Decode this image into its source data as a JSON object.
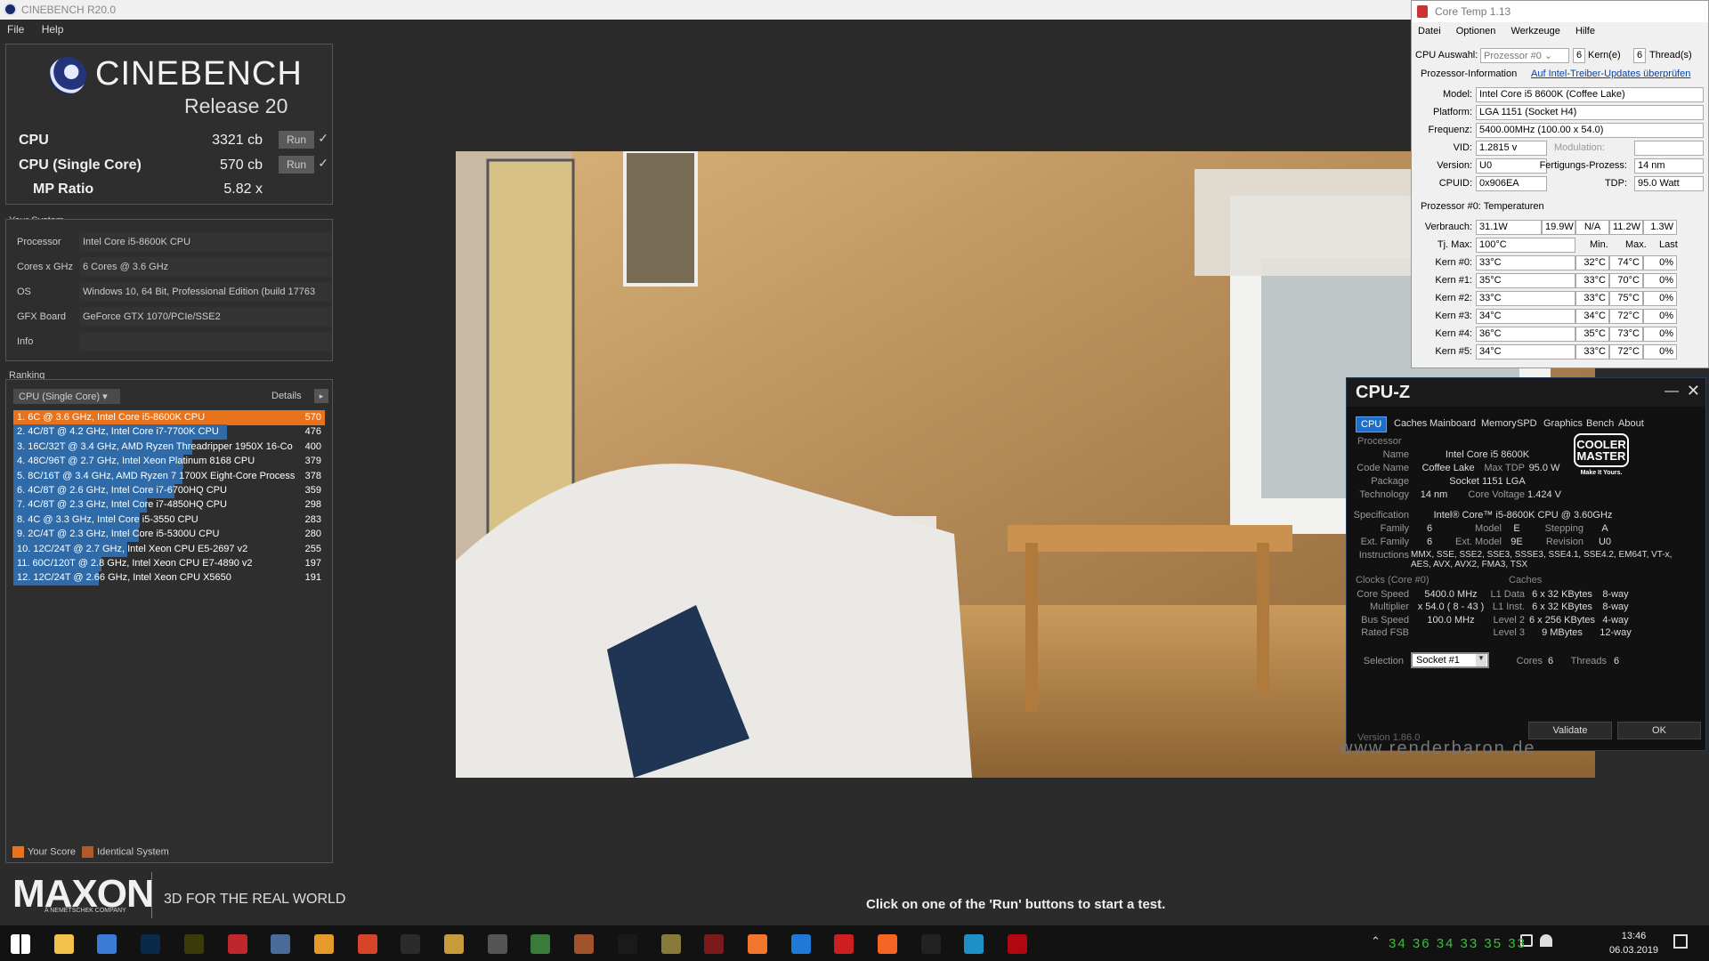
{
  "cinebench": {
    "window_title": "CINEBENCH R20.0",
    "menu": [
      "File",
      "Help"
    ],
    "logo_title": "CINEBENCH",
    "logo_release": "Release 20",
    "scores": [
      {
        "label": "CPU",
        "value": "3321 cb",
        "run": "Run",
        "check": "✓"
      },
      {
        "label": "CPU (Single Core)",
        "value": "570 cb",
        "run": "Run",
        "check": "✓"
      }
    ],
    "mp_ratio": {
      "label": "MP Ratio",
      "value": "5.82 x"
    },
    "your_system": {
      "title": "Your System",
      "rows": [
        {
          "key": "Processor",
          "value": "Intel Core i5-8600K CPU"
        },
        {
          "key": "Cores x GHz",
          "value": "6 Cores @ 3.6 GHz"
        },
        {
          "key": "OS",
          "value": "Windows 10, 64 Bit, Professional Edition (build 17763"
        },
        {
          "key": "GFX Board",
          "value": "GeForce GTX 1070/PCIe/SSE2"
        },
        {
          "key": "Info",
          "value": ""
        }
      ]
    },
    "ranking": {
      "title": "Ranking",
      "dropdown": "CPU (Single Core)",
      "details": "Details",
      "rows": [
        {
          "text": "1. 6C @ 3.6 GHz, Intel Core i5-8600K CPU",
          "score": 570,
          "mine": true
        },
        {
          "text": "2. 4C/8T @ 4.2 GHz, Intel Core i7-7700K CPU",
          "score": 476
        },
        {
          "text": "3. 16C/32T @ 3.4 GHz, AMD Ryzen Threadripper 1950X 16-Co",
          "score": 400
        },
        {
          "text": "4. 48C/96T @ 2.7 GHz, Intel Xeon Platinum 8168 CPU",
          "score": 379
        },
        {
          "text": "5. 8C/16T @ 3.4 GHz, AMD Ryzen 7 1700X Eight-Core Process",
          "score": 378
        },
        {
          "text": "6. 4C/8T @ 2.6 GHz, Intel Core i7-6700HQ CPU",
          "score": 359
        },
        {
          "text": "7. 4C/8T @ 2.3 GHz, Intel Core i7-4850HQ CPU",
          "score": 298
        },
        {
          "text": "8. 4C @ 3.3 GHz, Intel Core i5-3550 CPU",
          "score": 283
        },
        {
          "text": "9. 2C/4T @ 2.3 GHz, Intel Core i5-5300U CPU",
          "score": 280
        },
        {
          "text": "10. 12C/24T @ 2.7 GHz, Intel Xeon CPU E5-2697 v2",
          "score": 255
        },
        {
          "text": "11. 60C/120T @ 2.8 GHz, Intel Xeon CPU E7-4890 v2",
          "score": 197
        },
        {
          "text": "12. 12C/24T @ 2.66 GHz, Intel Xeon CPU X5650",
          "score": 191
        }
      ]
    },
    "legend": {
      "your_score": "Your Score",
      "identical": "Identical System"
    },
    "maxon": {
      "logo": "MAXON",
      "sub": "A NEMETSCHEK COMPANY",
      "tagline": "3D FOR THE REAL WORLD"
    },
    "status": "Click on one of the 'Run' buttons to start a test.",
    "colors": {
      "mine": "#e8731c",
      "bar": "#2e6ba8"
    }
  },
  "coretemp": {
    "title": "Core Temp 1.13",
    "menu": [
      "Datei",
      "Optionen",
      "Werkzeuge",
      "Hilfe"
    ],
    "cpu_select_label": "CPU Auswahl:",
    "cpu_select": "Prozessor #0",
    "cores": "6",
    "cores_label": "Kern(e)",
    "threads": "6",
    "threads_label": "Thread(s)",
    "info_label": "Prozessor-Information",
    "link": "Auf Intel-Treiber-Updates überprüfen",
    "model_label": "Model:",
    "model": "Intel Core i5 8600K (Coffee Lake)",
    "platform_label": "Platform:",
    "platform": "LGA 1151 (Socket H4)",
    "freq_label": "Frequenz:",
    "freq": "5400.00MHz (100.00 x 54.0)",
    "vid_label": "VID:",
    "vid": "1.2815 v",
    "mod_label": "Modulation:",
    "version_label": "Version:",
    "version": "U0",
    "process_label": "Fertigungs-Prozess:",
    "process": "14 nm",
    "cpuid_label": "CPUID:",
    "cpuid": "0x906EA",
    "tdp_label": "TDP:",
    "tdp": "95.0 Watt",
    "temps_title": "Prozessor #0: Temperaturen",
    "power_label": "Verbrauch:",
    "power": [
      "31.1W",
      "19.9W",
      "N/A",
      "11.2W",
      "1.3W"
    ],
    "tjmax_label": "Tj. Max:",
    "tjmax": "100°C",
    "col_min": "Min.",
    "col_max": "Max.",
    "col_last": "Last",
    "cores_rows": [
      {
        "label": "Kern #0:",
        "temp": "33°C",
        "min": "32°C",
        "max": "74°C",
        "load": "0%"
      },
      {
        "label": "Kern #1:",
        "temp": "35°C",
        "min": "33°C",
        "max": "70°C",
        "load": "0%"
      },
      {
        "label": "Kern #2:",
        "temp": "33°C",
        "min": "33°C",
        "max": "75°C",
        "load": "0%"
      },
      {
        "label": "Kern #3:",
        "temp": "34°C",
        "min": "34°C",
        "max": "72°C",
        "load": "0%"
      },
      {
        "label": "Kern #4:",
        "temp": "36°C",
        "min": "35°C",
        "max": "73°C",
        "load": "0%"
      },
      {
        "label": "Kern #5:",
        "temp": "34°C",
        "min": "33°C",
        "max": "72°C",
        "load": "0%"
      }
    ]
  },
  "cpuz": {
    "title": "CPU-Z",
    "tabs": [
      "CPU",
      "Caches",
      "Mainboard",
      "Memory",
      "SPD",
      "Graphics",
      "Bench",
      "About"
    ],
    "processor_group": "Processor",
    "name_l": "Name",
    "name": "Intel Core i5 8600K",
    "code_l": "Code Name",
    "code": "Coffee Lake",
    "maxtdp_l": "Max TDP",
    "maxtdp": "95.0 W",
    "package_l": "Package",
    "package": "Socket 1151 LGA",
    "tech_l": "Technology",
    "tech": "14 nm",
    "cv_l": "Core Voltage",
    "cv": "1.424 V",
    "spec_l": "Specification",
    "spec": "Intel® Core™ i5-8600K CPU @ 3.60GHz",
    "family_l": "Family",
    "family": "6",
    "model_l": "Model",
    "model": "E",
    "stepping_l": "Stepping",
    "stepping": "A",
    "extfam_l": "Ext. Family",
    "extfam": "6",
    "extmodel_l": "Ext. Model",
    "extmodel": "9E",
    "revision_l": "Revision",
    "revision": "U0",
    "instr_l": "Instructions",
    "instr1": "MMX, SSE, SSE2, SSE3, SSSE3, SSE4.1, SSE4.2, EM64T, VT-x,",
    "instr2": "AES, AVX, AVX2, FMA3, TSX",
    "clocks_group": "Clocks (Core #0)",
    "caches_group": "Caches",
    "corespeed_l": "Core Speed",
    "corespeed": "5400.0 MHz",
    "mult_l": "Multiplier",
    "mult": "x 54.0 ( 8 - 43 )",
    "bus_l": "Bus Speed",
    "bus": "100.0 MHz",
    "fsb_l": "Rated FSB",
    "l1d_l": "L1 Data",
    "l1d": "6 x 32 KBytes",
    "l1d_w": "8-way",
    "l1i_l": "L1 Inst.",
    "l1i": "6 x 32 KBytes",
    "l1i_w": "8-way",
    "l2_l": "Level 2",
    "l2": "6 x 256 KBytes",
    "l2_w": "4-way",
    "l3_l": "Level 3",
    "l3": "9 MBytes",
    "l3_w": "12-way",
    "selection_l": "Selection",
    "selection": "Socket #1",
    "cores_l": "Cores",
    "cores": "6",
    "threads_l": "Threads",
    "threads": "6",
    "version": "Version 1.86.0",
    "validate": "Validate",
    "ok": "OK",
    "logo_line1": "COOLER",
    "logo_line2": "MASTER",
    "logo_tag": "Make It Yours."
  },
  "render": {
    "watermark": "www.renderbaron.de"
  },
  "taskbar": {
    "temps": "34 36 34 33 35 33",
    "time": "13:46",
    "date": "06.03.2019",
    "icon_names": [
      "windows-start-icon",
      "file-explorer-icon",
      "cortana-icon",
      "photoshop-icon",
      "fireworks-icon",
      "aida64-icon",
      "app-icon",
      "media-icon",
      "cinebench-icon",
      "cinebench-logo-icon",
      "app2-icon",
      "cpuz-icon",
      "gpuz-icon",
      "coretemp-icon",
      "game-icon",
      "game2-icon",
      "video-icon",
      "rss-icon",
      "edge-icon",
      "opera-icon",
      "firefox-icon",
      "hwinfo-icon",
      "nineteen-icon",
      "netflix-icon"
    ]
  }
}
